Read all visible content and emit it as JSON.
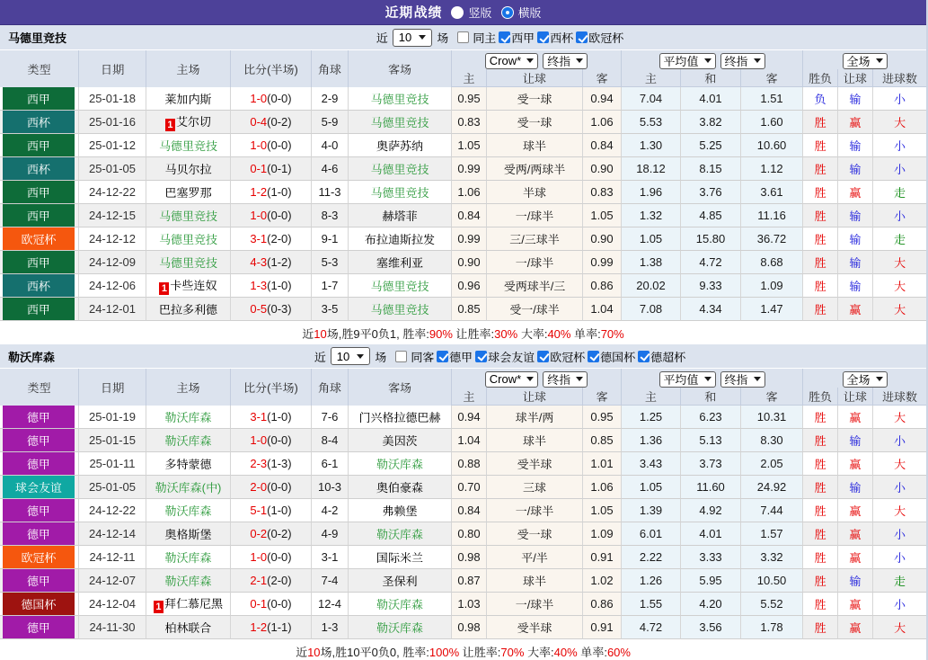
{
  "topbar": {
    "title": "近期战绩",
    "radios": [
      {
        "label": "竖版",
        "selected": false
      },
      {
        "label": "横版",
        "selected": true
      }
    ]
  },
  "columns": {
    "type": "类型",
    "date": "日期",
    "home": "主场",
    "score": "比分(半场)",
    "corner": "角球",
    "away": "客场",
    "odds_home": "主",
    "odds_handicap": "让球",
    "odds_away": "客",
    "mean_home": "主",
    "mean_draw": "和",
    "mean_away": "客",
    "result": "胜负",
    "handicap": "让球",
    "goals": "进球数"
  },
  "selects": {
    "odds_company": "Crow*",
    "odds_stage": "终指",
    "mean_type": "平均值",
    "mean_stage": "终指",
    "scope": "全场"
  },
  "filter_labels": {
    "recent": "近",
    "games": "场"
  },
  "league_colors": {
    "西甲": "#0e6c39",
    "西杯": "#15706e",
    "欧冠杯": "#f5570e",
    "德甲": "#a11ba8",
    "球会友谊": "#10a8a2",
    "德国杯": "#9e1310"
  },
  "text_colors": {
    "red": "#e60000",
    "blue": "#2020dd",
    "team_green": "#2e9b3d",
    "goal_green": "#0e8a12"
  },
  "sections": [
    {
      "team": "马德里竞技",
      "filter": {
        "count": "10",
        "checks": [
          {
            "label": "同主",
            "checked": false
          },
          {
            "label": "西甲",
            "checked": true
          },
          {
            "label": "西杯",
            "checked": true
          },
          {
            "label": "欧冠杯",
            "checked": true
          }
        ]
      },
      "rows": [
        {
          "league": "西甲",
          "date": "25-01-18",
          "home": "莱加内斯",
          "home_color": "black",
          "home_rank": "",
          "score": "1-0",
          "half": "(0-0)",
          "corner": "2-9",
          "away": "马德里竞技",
          "away_color": "green",
          "odds": [
            "0.95",
            "受一球",
            "0.94"
          ],
          "means": [
            "7.04",
            "4.01",
            "1.51"
          ],
          "result": [
            "负",
            "blue"
          ],
          "handicap": [
            "输",
            "blue"
          ],
          "goals": [
            "小",
            "blue"
          ]
        },
        {
          "league": "西杯",
          "date": "25-01-16",
          "home": "艾尔切",
          "home_color": "black",
          "home_rank": "1",
          "score": "0-4",
          "half": "(0-2)",
          "corner": "5-9",
          "away": "马德里竞技",
          "away_color": "green",
          "odds": [
            "0.83",
            "受一球",
            "1.06"
          ],
          "means": [
            "5.53",
            "3.82",
            "1.60"
          ],
          "result": [
            "胜",
            "red"
          ],
          "handicap": [
            "赢",
            "red"
          ],
          "goals": [
            "大",
            "red"
          ]
        },
        {
          "league": "西甲",
          "date": "25-01-12",
          "home": "马德里竞技",
          "home_color": "green",
          "home_rank": "",
          "score": "1-0",
          "half": "(0-0)",
          "corner": "4-0",
          "away": "奥萨苏纳",
          "away_color": "black",
          "odds": [
            "1.05",
            "球半",
            "0.84"
          ],
          "means": [
            "1.30",
            "5.25",
            "10.60"
          ],
          "result": [
            "胜",
            "red"
          ],
          "handicap": [
            "输",
            "blue"
          ],
          "goals": [
            "小",
            "blue"
          ]
        },
        {
          "league": "西杯",
          "date": "25-01-05",
          "home": "马贝尔拉",
          "home_color": "black",
          "home_rank": "",
          "score": "0-1",
          "half": "(0-1)",
          "corner": "4-6",
          "away": "马德里竞技",
          "away_color": "green",
          "odds": [
            "0.99",
            "受两/两球半",
            "0.90"
          ],
          "means": [
            "18.12",
            "8.15",
            "1.12"
          ],
          "result": [
            "胜",
            "red"
          ],
          "handicap": [
            "输",
            "blue"
          ],
          "goals": [
            "小",
            "blue"
          ]
        },
        {
          "league": "西甲",
          "date": "24-12-22",
          "home": "巴塞罗那",
          "home_color": "black",
          "home_rank": "",
          "score": "1-2",
          "half": "(1-0)",
          "corner": "11-3",
          "away": "马德里竞技",
          "away_color": "green",
          "odds": [
            "1.06",
            "半球",
            "0.83"
          ],
          "means": [
            "1.96",
            "3.76",
            "3.61"
          ],
          "result": [
            "胜",
            "red"
          ],
          "handicap": [
            "赢",
            "red"
          ],
          "goals": [
            "走",
            "green"
          ]
        },
        {
          "league": "西甲",
          "date": "24-12-15",
          "home": "马德里竞技",
          "home_color": "green",
          "home_rank": "",
          "score": "1-0",
          "half": "(0-0)",
          "corner": "8-3",
          "away": "赫塔菲",
          "away_color": "black",
          "odds": [
            "0.84",
            "一/球半",
            "1.05"
          ],
          "means": [
            "1.32",
            "4.85",
            "11.16"
          ],
          "result": [
            "胜",
            "red"
          ],
          "handicap": [
            "输",
            "blue"
          ],
          "goals": [
            "小",
            "blue"
          ]
        },
        {
          "league": "欧冠杯",
          "date": "24-12-12",
          "home": "马德里竞技",
          "home_color": "green",
          "home_rank": "",
          "score": "3-1",
          "half": "(2-0)",
          "corner": "9-1",
          "away": "布拉迪斯拉发",
          "away_color": "black",
          "odds": [
            "0.99",
            "三/三球半",
            "0.90"
          ],
          "means": [
            "1.05",
            "15.80",
            "36.72"
          ],
          "result": [
            "胜",
            "red"
          ],
          "handicap": [
            "输",
            "blue"
          ],
          "goals": [
            "走",
            "green"
          ]
        },
        {
          "league": "西甲",
          "date": "24-12-09",
          "home": "马德里竞技",
          "home_color": "green",
          "home_rank": "",
          "score": "4-3",
          "half": "(1-2)",
          "corner": "5-3",
          "away": "塞维利亚",
          "away_color": "black",
          "odds": [
            "0.90",
            "一/球半",
            "0.99"
          ],
          "means": [
            "1.38",
            "4.72",
            "8.68"
          ],
          "result": [
            "胜",
            "red"
          ],
          "handicap": [
            "输",
            "blue"
          ],
          "goals": [
            "大",
            "red"
          ]
        },
        {
          "league": "西杯",
          "date": "24-12-06",
          "home": "卡些连奴",
          "home_color": "black",
          "home_rank": "1",
          "score": "1-3",
          "half": "(1-0)",
          "corner": "1-7",
          "away": "马德里竞技",
          "away_color": "green",
          "odds": [
            "0.96",
            "受两球半/三",
            "0.86"
          ],
          "means": [
            "20.02",
            "9.33",
            "1.09"
          ],
          "result": [
            "胜",
            "red"
          ],
          "handicap": [
            "输",
            "blue"
          ],
          "goals": [
            "大",
            "red"
          ]
        },
        {
          "league": "西甲",
          "date": "24-12-01",
          "home": "巴拉多利德",
          "home_color": "black",
          "home_rank": "",
          "score": "0-5",
          "half": "(0-3)",
          "corner": "3-5",
          "away": "马德里竞技",
          "away_color": "green",
          "odds": [
            "0.85",
            "受一/球半",
            "1.04"
          ],
          "means": [
            "7.08",
            "4.34",
            "1.47"
          ],
          "result": [
            "胜",
            "red"
          ],
          "handicap": [
            "赢",
            "red"
          ],
          "goals": [
            "大",
            "red"
          ]
        }
      ],
      "summary": [
        [
          "近",
          "k"
        ],
        [
          "10",
          "r"
        ],
        [
          "场,胜9平0负1, 胜率:",
          "k"
        ],
        [
          "90%",
          "r"
        ],
        [
          " 让胜率:",
          "k"
        ],
        [
          "30%",
          "r"
        ],
        [
          " 大率:",
          "k"
        ],
        [
          "40%",
          "r"
        ],
        [
          " 单率:",
          "k"
        ],
        [
          "70%",
          "r"
        ]
      ]
    },
    {
      "team": "勒沃库森",
      "filter": {
        "count": "10",
        "checks": [
          {
            "label": "同客",
            "checked": false
          },
          {
            "label": "德甲",
            "checked": true
          },
          {
            "label": "球会友谊",
            "checked": true
          },
          {
            "label": "欧冠杯",
            "checked": true
          },
          {
            "label": "德国杯",
            "checked": true
          },
          {
            "label": "德超杯",
            "checked": true
          }
        ]
      },
      "rows": [
        {
          "league": "德甲",
          "date": "25-01-19",
          "home": "勒沃库森",
          "home_color": "green",
          "home_rank": "",
          "score": "3-1",
          "half": "(1-0)",
          "corner": "7-6",
          "away": "门兴格拉德巴赫",
          "away_color": "black",
          "odds": [
            "0.94",
            "球半/两",
            "0.95"
          ],
          "means": [
            "1.25",
            "6.23",
            "10.31"
          ],
          "result": [
            "胜",
            "red"
          ],
          "handicap": [
            "赢",
            "red"
          ],
          "goals": [
            "大",
            "red"
          ]
        },
        {
          "league": "德甲",
          "date": "25-01-15",
          "home": "勒沃库森",
          "home_color": "green",
          "home_rank": "",
          "score": "1-0",
          "half": "(0-0)",
          "corner": "8-4",
          "away": "美因茨",
          "away_color": "black",
          "odds": [
            "1.04",
            "球半",
            "0.85"
          ],
          "means": [
            "1.36",
            "5.13",
            "8.30"
          ],
          "result": [
            "胜",
            "red"
          ],
          "handicap": [
            "输",
            "blue"
          ],
          "goals": [
            "小",
            "blue"
          ]
        },
        {
          "league": "德甲",
          "date": "25-01-11",
          "home": "多特蒙德",
          "home_color": "black",
          "home_rank": "",
          "score": "2-3",
          "half": "(1-3)",
          "corner": "6-1",
          "away": "勒沃库森",
          "away_color": "green",
          "odds": [
            "0.88",
            "受半球",
            "1.01"
          ],
          "means": [
            "3.43",
            "3.73",
            "2.05"
          ],
          "result": [
            "胜",
            "red"
          ],
          "handicap": [
            "赢",
            "red"
          ],
          "goals": [
            "大",
            "red"
          ]
        },
        {
          "league": "球会友谊",
          "date": "25-01-05",
          "home": "勒沃库森(中)",
          "home_color": "green",
          "home_rank": "",
          "score": "2-0",
          "half": "(0-0)",
          "corner": "10-3",
          "away": "奥伯豪森",
          "away_color": "black",
          "odds": [
            "0.70",
            "三球",
            "1.06"
          ],
          "means": [
            "1.05",
            "11.60",
            "24.92"
          ],
          "result": [
            "胜",
            "red"
          ],
          "handicap": [
            "输",
            "blue"
          ],
          "goals": [
            "小",
            "blue"
          ]
        },
        {
          "league": "德甲",
          "date": "24-12-22",
          "home": "勒沃库森",
          "home_color": "green",
          "home_rank": "",
          "score": "5-1",
          "half": "(1-0)",
          "corner": "4-2",
          "away": "弗赖堡",
          "away_color": "black",
          "odds": [
            "0.84",
            "一/球半",
            "1.05"
          ],
          "means": [
            "1.39",
            "4.92",
            "7.44"
          ],
          "result": [
            "胜",
            "red"
          ],
          "handicap": [
            "赢",
            "red"
          ],
          "goals": [
            "大",
            "red"
          ]
        },
        {
          "league": "德甲",
          "date": "24-12-14",
          "home": "奥格斯堡",
          "home_color": "black",
          "home_rank": "",
          "score": "0-2",
          "half": "(0-2)",
          "corner": "4-9",
          "away": "勒沃库森",
          "away_color": "green",
          "odds": [
            "0.80",
            "受一球",
            "1.09"
          ],
          "means": [
            "6.01",
            "4.01",
            "1.57"
          ],
          "result": [
            "胜",
            "red"
          ],
          "handicap": [
            "赢",
            "red"
          ],
          "goals": [
            "小",
            "blue"
          ]
        },
        {
          "league": "欧冠杯",
          "date": "24-12-11",
          "home": "勒沃库森",
          "home_color": "green",
          "home_rank": "",
          "score": "1-0",
          "half": "(0-0)",
          "corner": "3-1",
          "away": "国际米兰",
          "away_color": "black",
          "odds": [
            "0.98",
            "平/半",
            "0.91"
          ],
          "means": [
            "2.22",
            "3.33",
            "3.32"
          ],
          "result": [
            "胜",
            "red"
          ],
          "handicap": [
            "赢",
            "red"
          ],
          "goals": [
            "小",
            "blue"
          ]
        },
        {
          "league": "德甲",
          "date": "24-12-07",
          "home": "勒沃库森",
          "home_color": "green",
          "home_rank": "",
          "score": "2-1",
          "half": "(2-0)",
          "corner": "7-4",
          "away": "圣保利",
          "away_color": "black",
          "odds": [
            "0.87",
            "球半",
            "1.02"
          ],
          "means": [
            "1.26",
            "5.95",
            "10.50"
          ],
          "result": [
            "胜",
            "red"
          ],
          "handicap": [
            "输",
            "blue"
          ],
          "goals": [
            "走",
            "green"
          ]
        },
        {
          "league": "德国杯",
          "date": "24-12-04",
          "home": "拜仁慕尼黑",
          "home_color": "black",
          "home_rank": "1",
          "score": "0-1",
          "half": "(0-0)",
          "corner": "12-4",
          "away": "勒沃库森",
          "away_color": "green",
          "odds": [
            "1.03",
            "一/球半",
            "0.86"
          ],
          "means": [
            "1.55",
            "4.20",
            "5.52"
          ],
          "result": [
            "胜",
            "red"
          ],
          "handicap": [
            "赢",
            "red"
          ],
          "goals": [
            "小",
            "blue"
          ]
        },
        {
          "league": "德甲",
          "date": "24-11-30",
          "home": "柏林联合",
          "home_color": "black",
          "home_rank": "",
          "score": "1-2",
          "half": "(1-1)",
          "corner": "1-3",
          "away": "勒沃库森",
          "away_color": "green",
          "odds": [
            "0.98",
            "受半球",
            "0.91"
          ],
          "means": [
            "4.72",
            "3.56",
            "1.78"
          ],
          "result": [
            "胜",
            "red"
          ],
          "handicap": [
            "赢",
            "red"
          ],
          "goals": [
            "大",
            "red"
          ]
        }
      ],
      "summary": [
        [
          "近",
          "k"
        ],
        [
          "10",
          "r"
        ],
        [
          "场,胜10平0负0, 胜率:",
          "k"
        ],
        [
          "100%",
          "r"
        ],
        [
          " 让胜率:",
          "k"
        ],
        [
          "70%",
          "r"
        ],
        [
          " 大率:",
          "k"
        ],
        [
          "40%",
          "r"
        ],
        [
          " 单率:",
          "k"
        ],
        [
          "60%",
          "r"
        ]
      ]
    }
  ]
}
